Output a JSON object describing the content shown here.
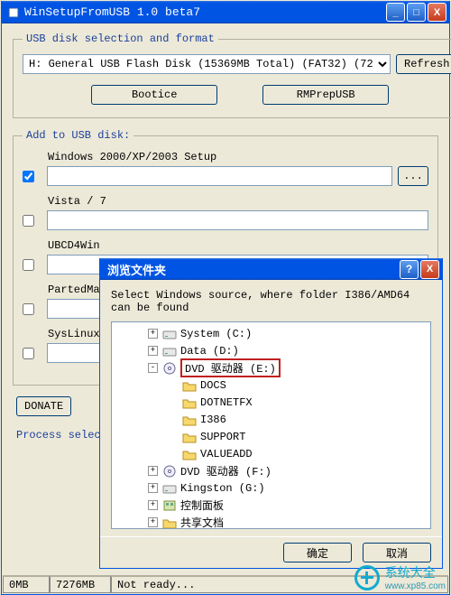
{
  "window": {
    "title": "WinSetupFromUSB 1.0 beta7",
    "min": "_",
    "max": "□",
    "close": "X"
  },
  "usb_section": {
    "legend": "USB disk selection and format",
    "selected": "H: General USB Flash Disk (15369MB Total) (FAT32) (72",
    "refresh": "Refresh",
    "bootice": "Bootice",
    "rmprepusb": "RMPrepUSB"
  },
  "add_section": {
    "legend": "Add to USB disk:",
    "rows": {
      "win2k": {
        "checked": true,
        "label": "Windows 2000/XP/2003 Setup",
        "value": ""
      },
      "vista": {
        "checked": false,
        "label": "Vista / 7",
        "value": ""
      },
      "ubcd": {
        "checked": false,
        "label": "UBCD4Win",
        "value": ""
      },
      "parted": {
        "checked": false,
        "label": "PartedMa",
        "value": ""
      },
      "syslinux": {
        "checked": false,
        "label": "SysLinux",
        "value": ""
      }
    },
    "browse": "..."
  },
  "under": {
    "donate": "DONATE",
    "process": "Process selec"
  },
  "status": {
    "cell1": "0MB",
    "cell2": "7276MB",
    "cell3": "Not ready..."
  },
  "dialog": {
    "title": "浏览文件夹",
    "help": "?",
    "close": "X",
    "instruction": "Select Windows source, where folder I386/AMD64 can be found",
    "ok": "确定",
    "cancel": "取消",
    "tree": [
      {
        "level": 2,
        "toggle": "+",
        "icon": "drive",
        "label": "System (C:)"
      },
      {
        "level": 2,
        "toggle": "+",
        "icon": "drive",
        "label": "Data (D:)"
      },
      {
        "level": 2,
        "toggle": "-",
        "icon": "cd",
        "label": "DVD 驱动器 (E:)",
        "highlight": true
      },
      {
        "level": 3,
        "toggle": " ",
        "icon": "folder",
        "label": "DOCS"
      },
      {
        "level": 3,
        "toggle": " ",
        "icon": "folder",
        "label": "DOTNETFX"
      },
      {
        "level": 3,
        "toggle": " ",
        "icon": "folder",
        "label": "I386"
      },
      {
        "level": 3,
        "toggle": " ",
        "icon": "folder",
        "label": "SUPPORT"
      },
      {
        "level": 3,
        "toggle": " ",
        "icon": "folder",
        "label": "VALUEADD"
      },
      {
        "level": 2,
        "toggle": "+",
        "icon": "cd",
        "label": "DVD 驱动器 (F:)"
      },
      {
        "level": 2,
        "toggle": "+",
        "icon": "drive",
        "label": "Kingston (G:)"
      },
      {
        "level": 2,
        "toggle": "+",
        "icon": "panel",
        "label": "控制面板"
      },
      {
        "level": 2,
        "toggle": "+",
        "icon": "folder",
        "label": "共享文档"
      }
    ]
  },
  "watermark": {
    "title": "系统大全",
    "url": "www.xp85.com"
  }
}
